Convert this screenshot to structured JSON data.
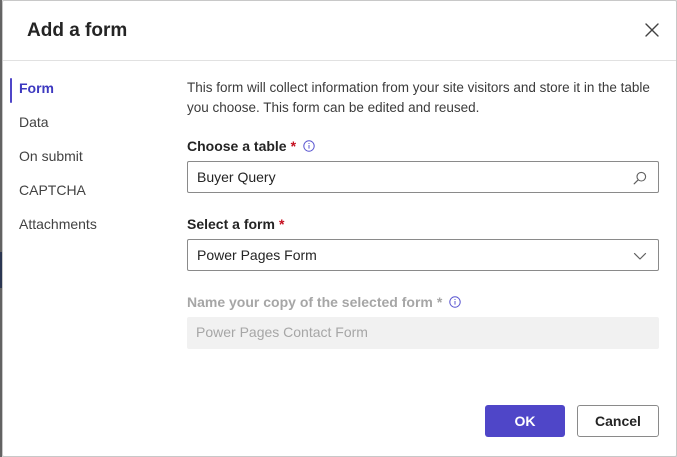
{
  "dialog": {
    "title": "Add a form"
  },
  "nav": {
    "items": [
      {
        "label": "Form",
        "active": true
      },
      {
        "label": "Data",
        "active": false
      },
      {
        "label": "On submit",
        "active": false
      },
      {
        "label": "CAPTCHA",
        "active": false
      },
      {
        "label": "Attachments",
        "active": false
      }
    ]
  },
  "form": {
    "description": "This form will collect information from your site visitors and store it in the table you choose. This form can be edited and reused.",
    "table_label": "Choose a table",
    "table_value": "Buyer Query",
    "form_label": "Select a form",
    "form_value": "Power Pages Form",
    "copy_label": "Name your copy of the selected form",
    "copy_placeholder": "Power Pages Contact Form",
    "required_mark": "*"
  },
  "buttons": {
    "ok": "OK",
    "cancel": "Cancel"
  },
  "icons": {
    "close": "close-icon",
    "info": "info-icon",
    "search": "search-icon",
    "dropdown": "chevron-down-icon"
  },
  "colors": {
    "accent": "#4f46c8",
    "required": "#c50f1f"
  }
}
